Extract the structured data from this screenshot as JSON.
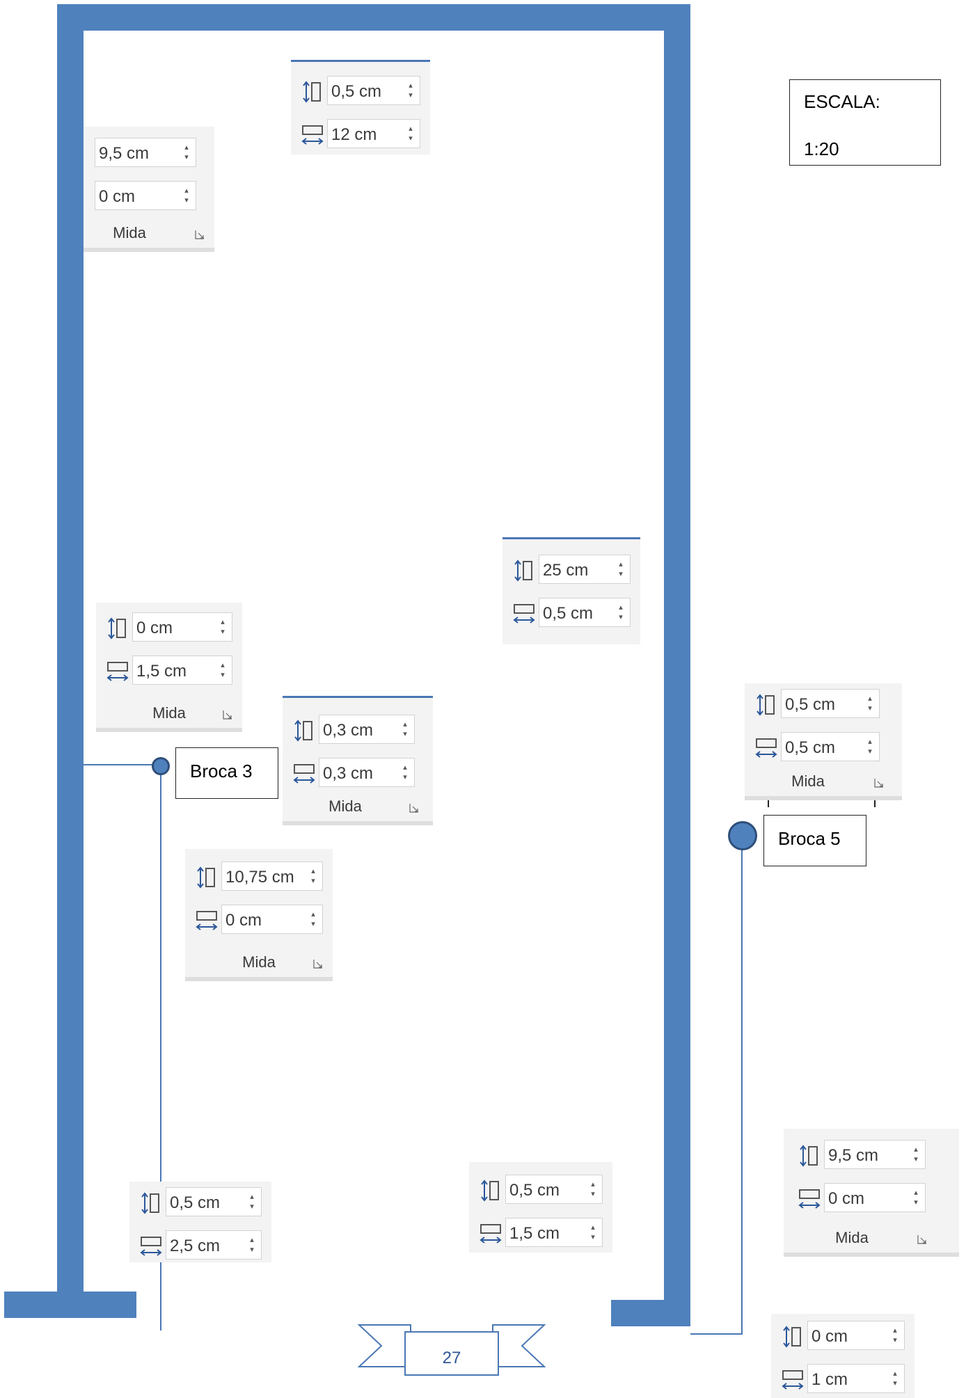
{
  "scale_box": {
    "title": "ESCALA:",
    "value": "1:20"
  },
  "panels": [
    {
      "height": "0,5 cm",
      "width": "12 cm"
    },
    {
      "height": "9,5 cm",
      "width": "0 cm",
      "label": "Mida"
    },
    {
      "height": "25 cm",
      "width": "0,5 cm"
    },
    {
      "height": "0 cm",
      "width": "1,5 cm",
      "label": "Mida"
    },
    {
      "height": "0,3 cm",
      "width": "0,3 cm",
      "label": "Mida"
    },
    {
      "height": "0,5 cm",
      "width": "0,5 cm",
      "label": "Mida"
    },
    {
      "height": "10,75 cm",
      "width": "0 cm",
      "label": "Mida"
    },
    {
      "height": "9,5 cm",
      "width": "0 cm",
      "label": "Mida"
    },
    {
      "height": "0,5 cm",
      "width": "2,5 cm"
    },
    {
      "height": "0,5 cm",
      "width": "1,5 cm"
    },
    {
      "height": "0 cm",
      "width": "1 cm"
    }
  ],
  "callouts": {
    "broca3": "Broca 3",
    "broca5": "Broca 5"
  },
  "page_number": "27",
  "colors": {
    "frame": "#4f81bd",
    "line": "#4a77b4"
  },
  "icons": {
    "height": "shape-height-icon",
    "width": "shape-width-icon",
    "launcher": "dialog-launcher-icon"
  }
}
